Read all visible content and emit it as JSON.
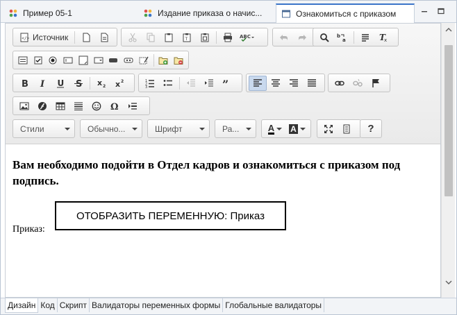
{
  "tabs": [
    {
      "label": "Пример 05-1",
      "icon": "process-icon"
    },
    {
      "label": "Издание приказа о начис...",
      "icon": "process-icon"
    },
    {
      "label": "Ознакомиться с приказом",
      "icon": "form-icon",
      "active": true,
      "close": "×"
    }
  ],
  "window_controls": [
    "minimize-icon",
    "maximize-icon"
  ],
  "toolbar": {
    "source_label": "Источник",
    "row1_icons": [
      "source-icon",
      "new-page-icon",
      "preview-icon",
      "cut-icon",
      "copy-icon",
      "paste-icon",
      "paste-text-icon",
      "paste-word-icon",
      "print-icon",
      "spellcheck-icon",
      "undo-icon",
      "redo-icon",
      "find-icon",
      "replace-icon",
      "select-all-icon",
      "remove-format-icon"
    ],
    "row2_icons": [
      "form-icon",
      "checkbox-icon",
      "radio-icon",
      "textfield-icon",
      "textarea-icon",
      "select-icon",
      "button-icon",
      "image-button-icon",
      "hidden-field-icon",
      "insert-variable-icon",
      "delete-variable-icon"
    ],
    "row3_icons": [
      "bold-icon",
      "italic-icon",
      "underline-icon",
      "strike-icon",
      "subscript-icon",
      "superscript-icon",
      "numbered-list-icon",
      "bulleted-list-icon",
      "outdent-icon",
      "indent-icon",
      "blockquote-icon",
      "align-left-icon",
      "align-center-icon",
      "align-right-icon",
      "justify-icon",
      "link-icon",
      "unlink-icon",
      "anchor-icon"
    ],
    "row4_icons": [
      "image-icon",
      "flash-icon",
      "table-icon",
      "horizontal-rule-icon",
      "smiley-icon",
      "special-char-icon",
      "page-break-icon"
    ],
    "styles_label": "Стили",
    "format_label": "Обычно...",
    "font_label": "Шрифт",
    "size_label": "Ра...",
    "text_color_label": "A",
    "bg_color_label": "A",
    "help_label": "?"
  },
  "content": {
    "heading": "Вам необходимо подойти в Отдел кадров и ознакомиться с приказом под подпись.",
    "variable_label": "Приказ:",
    "variable_box": "ОТОБРАЗИТЬ ПЕРЕМЕННУЮ: Приказ"
  },
  "bottom_tabs": [
    "Дизайн",
    "Код",
    "Скрипт",
    "Валидаторы переменных формы",
    "Глобальные валидаторы"
  ],
  "colors": {
    "accent": "#3a74c8",
    "toolbar": "#ececec",
    "border": "#c7d0dc"
  }
}
